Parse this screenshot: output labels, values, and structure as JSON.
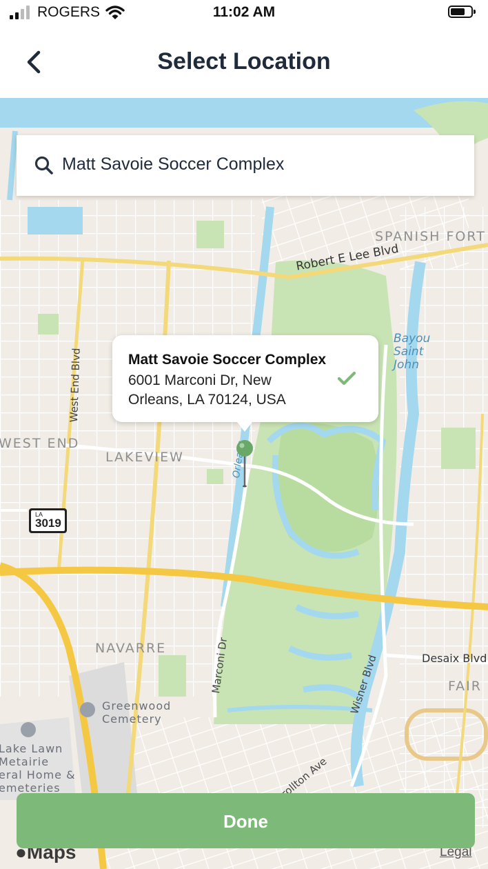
{
  "status_bar": {
    "carrier": "ROGERS",
    "time": "11:02 AM"
  },
  "nav": {
    "title": "Select Location"
  },
  "search": {
    "value": "Matt Savoie Soccer Complex"
  },
  "callout": {
    "name": "Matt Savoie Soccer Complex",
    "address": "6001 Marconi Dr, New Orleans, LA 70124, USA"
  },
  "map_labels": {
    "spanish_fort": "SPANISH FORT",
    "robert_e_lee": "Robert E Lee Blvd",
    "bayou_st_john": [
      "Bayou",
      "Saint",
      "John"
    ],
    "west_end_blvd": "West End Blvd",
    "west_end": "WEST END",
    "lakeview": "LAKEVIEW",
    "orleans": "Orleans",
    "route_shield_state": "LA",
    "route_shield_number": "3019",
    "navarre": "NAVARRE",
    "marconi_dr": "Marconi Dr",
    "wisner_blvd": "Wisner Blvd",
    "desaix_blvd": "Desaix Blvd",
    "fair": "FAIR",
    "greenwood_cemetery": [
      "Greenwood",
      "Cemetery"
    ],
    "lake_lawn": [
      "Lake Lawn",
      "Metairie",
      "eral Home &",
      "emeteries"
    ],
    "carrollton_ave": "rrollton Ave"
  },
  "done_button": {
    "label": "Done"
  },
  "attribution": {
    "maps": "Maps",
    "legal": "Legal"
  },
  "colors": {
    "accent_green": "#7dba79",
    "water": "#a3d8ef",
    "park": "#c9e4b4",
    "highway": "#f5c844"
  }
}
